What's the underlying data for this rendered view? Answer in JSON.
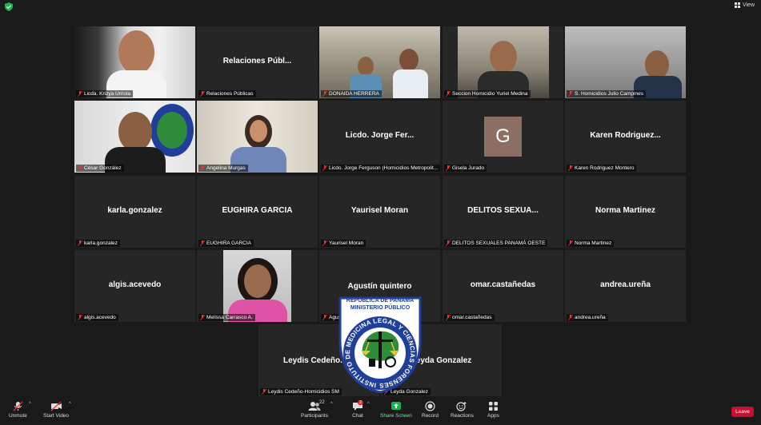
{
  "topbar": {
    "view_label": "View"
  },
  "tiles": [
    {
      "name": "Licda. Krizya Urriola",
      "big": ""
    },
    {
      "name": "Relaciones Públicas",
      "big": "Relaciones  Públ..."
    },
    {
      "name": "DONAIDA HERRERA",
      "big": ""
    },
    {
      "name": "Seccion Homicidio Yuriel Medina",
      "big": ""
    },
    {
      "name": "S. Homicidios Julio Campines",
      "big": ""
    },
    {
      "name": "César González",
      "big": ""
    },
    {
      "name": "Angelina Murgas",
      "big": ""
    },
    {
      "name": "Licdo. Jorge Ferguson (Homicidios Metropolit...",
      "big": "Licdo.  Jorge  Fer..."
    },
    {
      "name": "Gisela Jurado",
      "big": "",
      "avatar": "G"
    },
    {
      "name": "Karen Rodriguez Montero",
      "big": "Karen  Rodriguez..."
    },
    {
      "name": "karla.gonzalez",
      "big": "karla.gonzalez"
    },
    {
      "name": "EUGHIRA GARCIA",
      "big": "EUGHIRA GARCIA"
    },
    {
      "name": "Yaurisel Moran",
      "big": "Yaurisel Moran"
    },
    {
      "name": "DELITOS SEXUALES PANAMÁ OESTE",
      "big": "DELITOS  SEXUA..."
    },
    {
      "name": "Norma Martinez",
      "big": "Norma Martinez"
    },
    {
      "name": "algis.acevedo",
      "big": "algis.acevedo"
    },
    {
      "name": "Melissa Carrasco A.",
      "big": ""
    },
    {
      "name": "Agustín quintero",
      "big": "Agustín quintero"
    },
    {
      "name": "omar.castañedas",
      "big": "omar.castañedas"
    },
    {
      "name": "andrea.ureña",
      "big": "andrea.ureña"
    },
    {
      "name": "Leydis Cedeño-Homicidios SM",
      "big": "Leydis  Cedeño..."
    },
    {
      "name": "Leyda Gonzalez",
      "big": "Leyda Gonzalez"
    }
  ],
  "toolbar": {
    "unmute": "Unmute",
    "start_video": "Start Video",
    "participants": "Participants",
    "participants_count": "22",
    "chat": "Chat",
    "chat_badge": "2",
    "share_screen": "Share Screen",
    "record": "Record",
    "reactions": "Reactions",
    "apps": "Apps",
    "leave": "Leave"
  },
  "logo": {
    "top_text_1": "REPÚBLICA DE PANAMÁ",
    "top_text_2": "MINISTERIO PÚBLICO",
    "ring_text": "INSTITUTO DE MEDICINA LEGAL Y CIENCIAS FORENSES",
    "colors": {
      "blue": "#1f3f9a",
      "green": "#2e8b3a",
      "yellow": "#e8c52a"
    }
  },
  "colors": {
    "active_speaker": "#f1e05a",
    "leave": "#c8102e",
    "share": "#19b34a"
  }
}
